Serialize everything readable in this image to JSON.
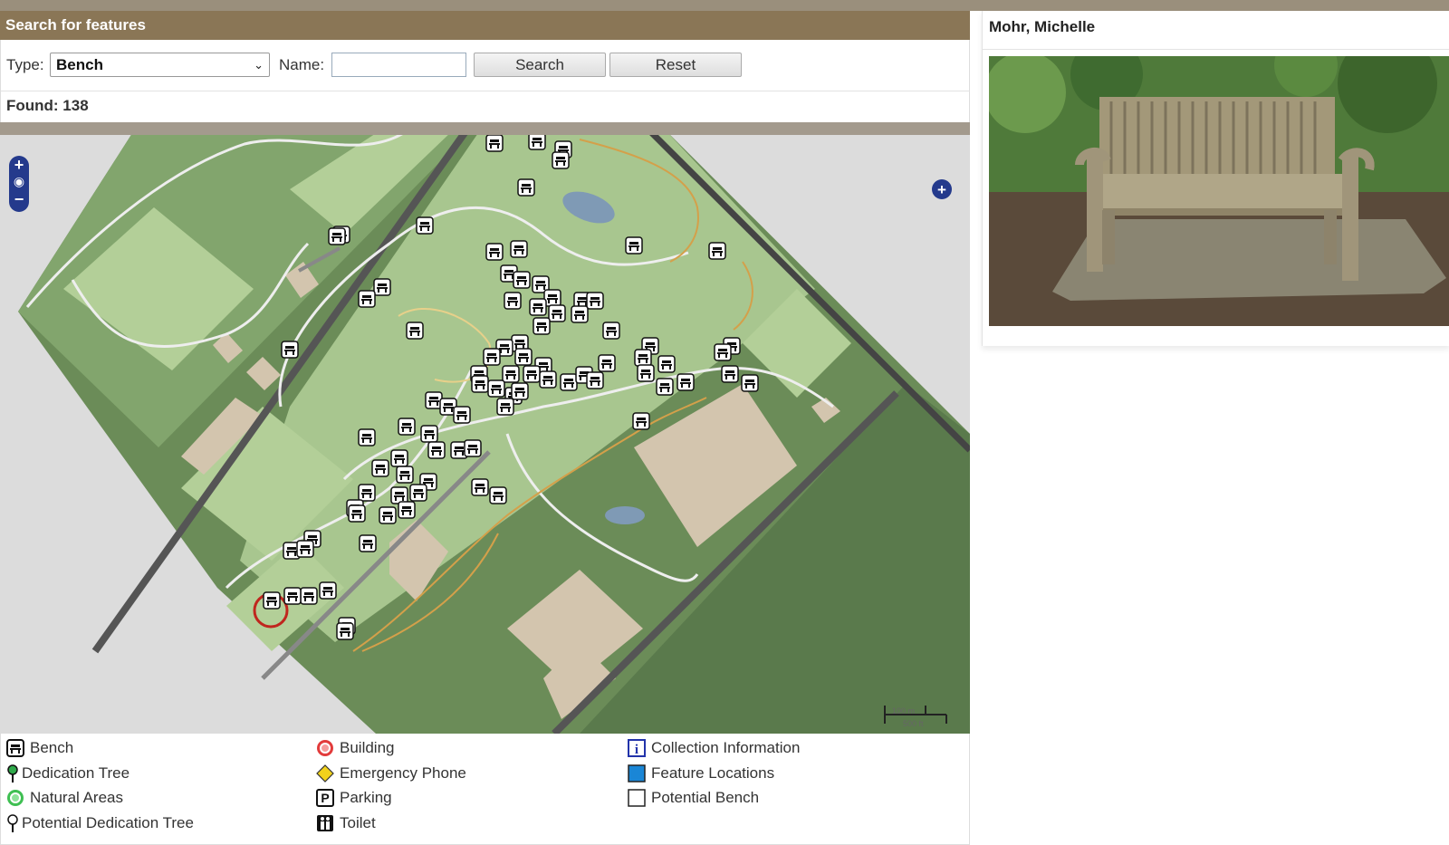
{
  "search": {
    "header": "Search for features",
    "type_label": "Type:",
    "type_value": "Bench",
    "name_label": "Name:",
    "name_value": "",
    "search_button": "Search",
    "reset_button": "Reset",
    "found_text": "Found: 138"
  },
  "map": {
    "zoom_in": "+",
    "zoom_out": "−",
    "scale_m": "100 m",
    "scale_ft": "500 ft",
    "expand": "+"
  },
  "legend": {
    "items": [
      {
        "label": "Bench",
        "icon": "bench-icon"
      },
      {
        "label": "Dedication Tree",
        "icon": "green-pin-icon"
      },
      {
        "label": "Natural Areas",
        "icon": "green-circle-icon"
      },
      {
        "label": "Potential Dedication Tree",
        "icon": "outline-pin-icon"
      },
      {
        "label": "Building",
        "icon": "red-target-icon"
      },
      {
        "label": "Emergency Phone",
        "icon": "yellow-diamond-icon"
      },
      {
        "label": "Parking",
        "icon": "parking-icon"
      },
      {
        "label": "Toilet",
        "icon": "toilet-icon"
      },
      {
        "label": "Collection Information",
        "icon": "info-icon"
      },
      {
        "label": "Feature Locations",
        "icon": "blue-square-icon"
      },
      {
        "label": "Potential Bench",
        "icon": "empty-square-icon"
      }
    ]
  },
  "detail": {
    "title": "Mohr, Michelle",
    "photo_icon": "bench-photo"
  },
  "colors": {
    "header_bg": "#8a7656",
    "map_green_dark": "#5f7d4f",
    "map_green_mid": "#7fa26a",
    "map_green_light": "#b7d19b",
    "building": "#d3c5ae",
    "zoom_blue": "#243a8c"
  }
}
